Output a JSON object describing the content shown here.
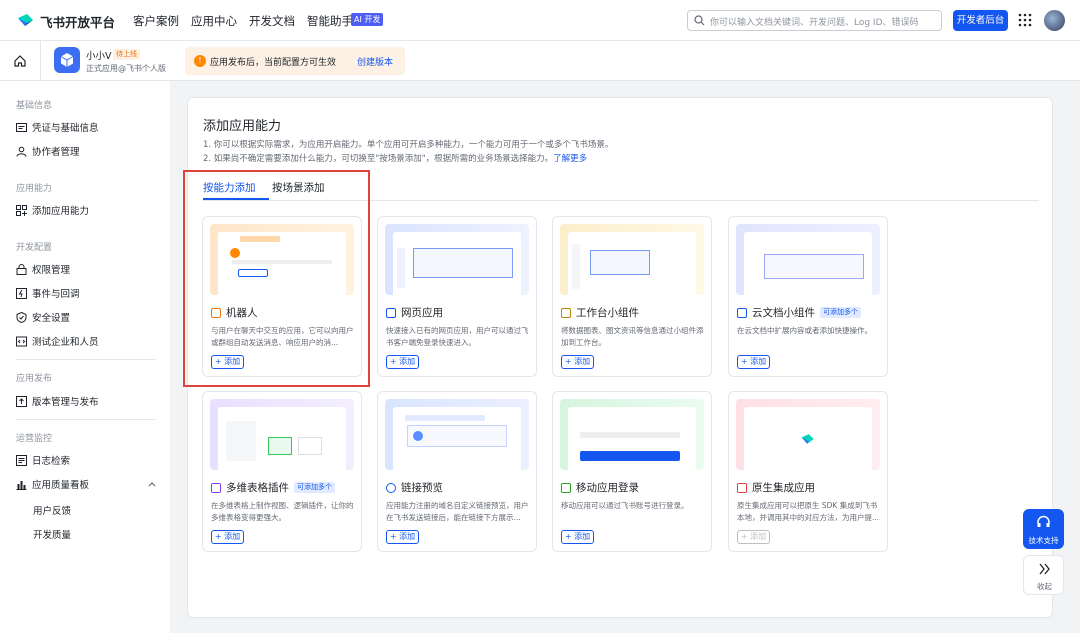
{
  "topbar": {
    "brand": "飞书开放平台",
    "nav": [
      "客户案例",
      "应用中心",
      "开发文档",
      "智能助手"
    ],
    "ai_badge": "AI 开发",
    "search_placeholder": "你可以输入文档关键词、开发问题、Log ID、错误码",
    "dev_console": "开发者后台"
  },
  "appbar": {
    "app_name": "小小V",
    "status": "待上线",
    "app_sub": "正式应用@飞书个人版",
    "notice": "应用发布后，当前配置方可生效",
    "notice_link": "创建版本"
  },
  "sidebar": {
    "groups": [
      {
        "title": "基础信息",
        "items": [
          "凭证与基础信息",
          "协作者管理"
        ]
      },
      {
        "title": "应用能力",
        "items": [
          "添加应用能力"
        ]
      },
      {
        "title": "开发配置",
        "items": [
          "权限管理",
          "事件与回调",
          "安全设置",
          "测试企业和人员"
        ]
      },
      {
        "title": "应用发布",
        "items": [
          "版本管理与发布"
        ]
      },
      {
        "title": "运营监控",
        "items": [
          "日志检索",
          "应用质量看板"
        ]
      }
    ],
    "subitems": [
      "用户反馈",
      "开发质量"
    ]
  },
  "main": {
    "title": "添加应用能力",
    "desc1": "1. 你可以根据实际需求，为应用开启能力。单个应用可开启多种能力，一个能力可用于一个或多个飞书场景。",
    "desc2": "2. 如果尚不确定需要添加什么能力，可切换至\"按场景添加\"，根据所需的业务场景选择能力。",
    "desc2_link": "了解更多",
    "tabs": [
      "按能力添加",
      "按场景添加"
    ],
    "add_label": "+ 添加",
    "more_badge": "可添加多个",
    "cards": [
      {
        "title": "机器人",
        "desc": "与用户在聊天中交互的应用，它可以向用户或群组自动发送消息、响应用户的消..."
      },
      {
        "title": "网页应用",
        "desc": "快速接入已有的网页应用，用户可以通过飞书客户端免登录快速进入。"
      },
      {
        "title": "工作台小组件",
        "desc": "将数据图表、图文资讯等信息通过小组件添加到工作台。"
      },
      {
        "title": "云文档小组件",
        "desc": "在云文档中扩展内容或者添加快捷操作。"
      },
      {
        "title": "多维表格插件",
        "desc": "在多维表格上制作视图、逻辑插件，让你的多维表格变得更强大。"
      },
      {
        "title": "链接预览",
        "desc": "应用能力注册的域名自定义链接预览，用户在飞书发送链接后，能在链接下方展示..."
      },
      {
        "title": "移动应用登录",
        "desc": "移动应用可以通过飞书账号进行登录。"
      },
      {
        "title": "原生集成应用",
        "desc": "原生集成应用可以把原生 SDK 集成到飞书本地，并调用其中的对应方法，为用户提..."
      }
    ]
  },
  "float": {
    "support": "技术支持",
    "collapse": "收起"
  }
}
